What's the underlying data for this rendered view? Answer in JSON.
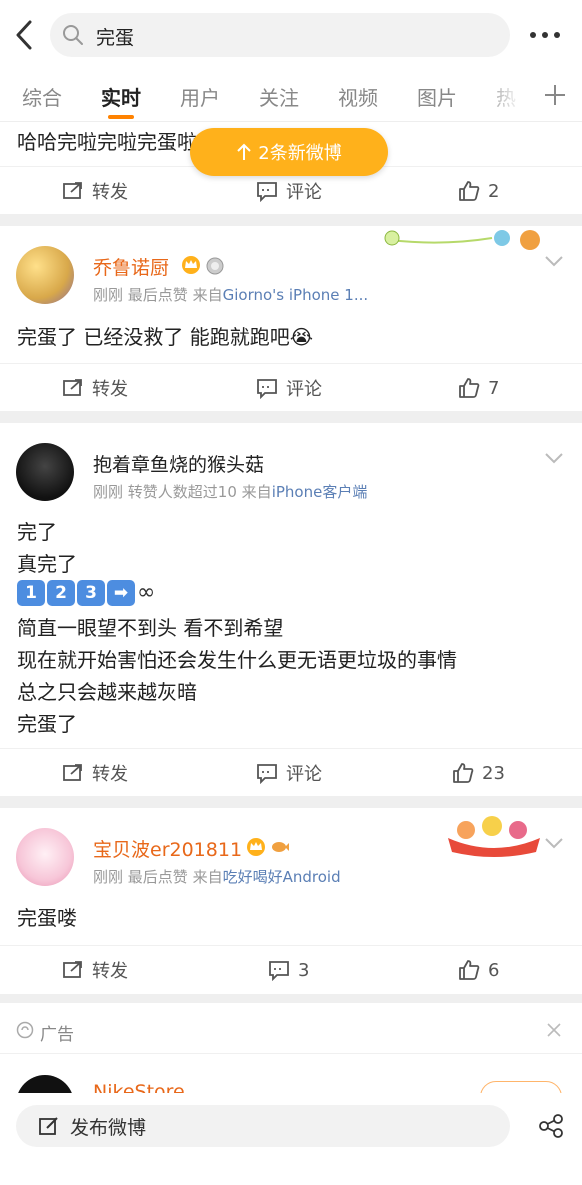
{
  "search": {
    "query": "完蛋"
  },
  "tabs": [
    {
      "label": "综合"
    },
    {
      "label": "实时"
    },
    {
      "label": "用户"
    },
    {
      "label": "关注"
    },
    {
      "label": "视频"
    },
    {
      "label": "图片"
    },
    {
      "label": "热"
    }
  ],
  "new_posts": {
    "label": "2条新微博"
  },
  "posts": [
    {
      "text_lines": [
        "哈哈完啦完啦完蛋啦"
      ],
      "actions": {
        "repost": "转发",
        "comment": "评论",
        "like": "2"
      }
    },
    {
      "author": "乔鲁诺厨",
      "time": "刚刚",
      "note": "最后点赞",
      "source_prefix": "来自",
      "source": "Giorno's iPhone 1...",
      "text_lines": [
        "完蛋了 已经没救了 能跑就跑吧😭"
      ],
      "actions": {
        "repost": "转发",
        "comment": "评论",
        "like": "7"
      }
    },
    {
      "author": "抱着章鱼烧的猴头菇",
      "time": "刚刚",
      "note": "转赞人数超过10",
      "source_prefix": "来自",
      "source": "iPhone客户端",
      "text_lines": [
        "完了",
        "真完了",
        "",
        "简直一眼望不到头 看不到希望",
        "现在就开始害怕还会发生什么更无语更垃圾的事情",
        "总之只会越来越灰暗",
        "完蛋了"
      ],
      "emoji_keys": [
        "1",
        "2",
        "3",
        "➡"
      ],
      "emoji_tail": "∞",
      "actions": {
        "repost": "转发",
        "comment": "评论",
        "like": "23"
      }
    },
    {
      "author": "宝贝波er201811",
      "time": "刚刚",
      "note": "最后点赞",
      "source_prefix": "来自",
      "source": "吃好喝好Android",
      "text_lines": [
        "完蛋喽"
      ],
      "actions": {
        "repost": "转发",
        "comment": "3",
        "like": "6"
      }
    }
  ],
  "ad": {
    "label": "广告",
    "name": "NikeStore"
  },
  "bottom": {
    "post_label": "发布微博"
  },
  "colors": {
    "accent": "#ff8200",
    "pill": "#ffb11b",
    "author": "#e8681a",
    "link": "#5b7fb5"
  }
}
